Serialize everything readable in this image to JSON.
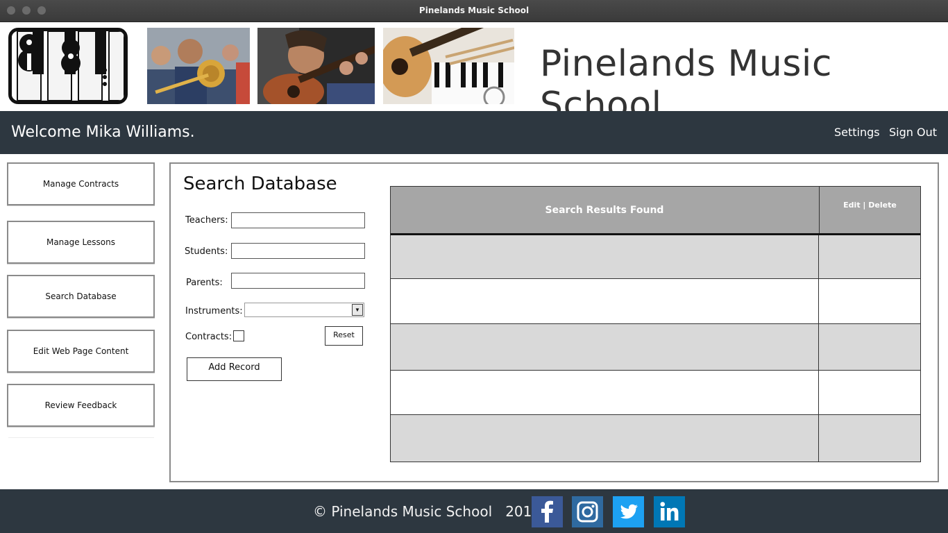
{
  "window": {
    "title": "Pinelands Music School"
  },
  "header": {
    "site_title": "Pinelands Music School"
  },
  "navbar": {
    "welcome": "Welcome Mika Williams.",
    "settings_label": "Settings",
    "signout_label": "Sign Out"
  },
  "sidebar": {
    "items": [
      {
        "label": "Manage Contracts"
      },
      {
        "label": "Manage Lessons"
      },
      {
        "label": "Search Database"
      },
      {
        "label": "Edit Web Page Content"
      },
      {
        "label": "Review Feedback"
      }
    ]
  },
  "search": {
    "title": "Search Database",
    "teachers_label": "Teachers:",
    "teachers_value": "",
    "students_label": "Students:",
    "students_value": "",
    "parents_label": "Parents:",
    "parents_value": "",
    "instruments_label": "Instruments:",
    "instruments_value": "",
    "contracts_label": "Contracts:",
    "contracts_checked": false,
    "reset_label": "Reset",
    "add_record_label": "Add Record"
  },
  "results": {
    "header_main": "Search Results Found",
    "header_actions": "Edit | Delete",
    "rows": [
      "",
      "",
      "",
      "",
      ""
    ]
  },
  "footer": {
    "copyright": "© Pinelands Music School   2018",
    "social": [
      {
        "name": "facebook-icon",
        "color": "#3b5998"
      },
      {
        "name": "instagram-icon",
        "color": "#2f6aa0"
      },
      {
        "name": "twitter-icon",
        "color": "#1da1f2"
      },
      {
        "name": "linkedin-icon",
        "color": "#0077b5"
      }
    ]
  },
  "colors": {
    "nav_bg": "#2d3740",
    "table_header": "#a6a6a6",
    "row_grey": "#d9d9d9"
  }
}
